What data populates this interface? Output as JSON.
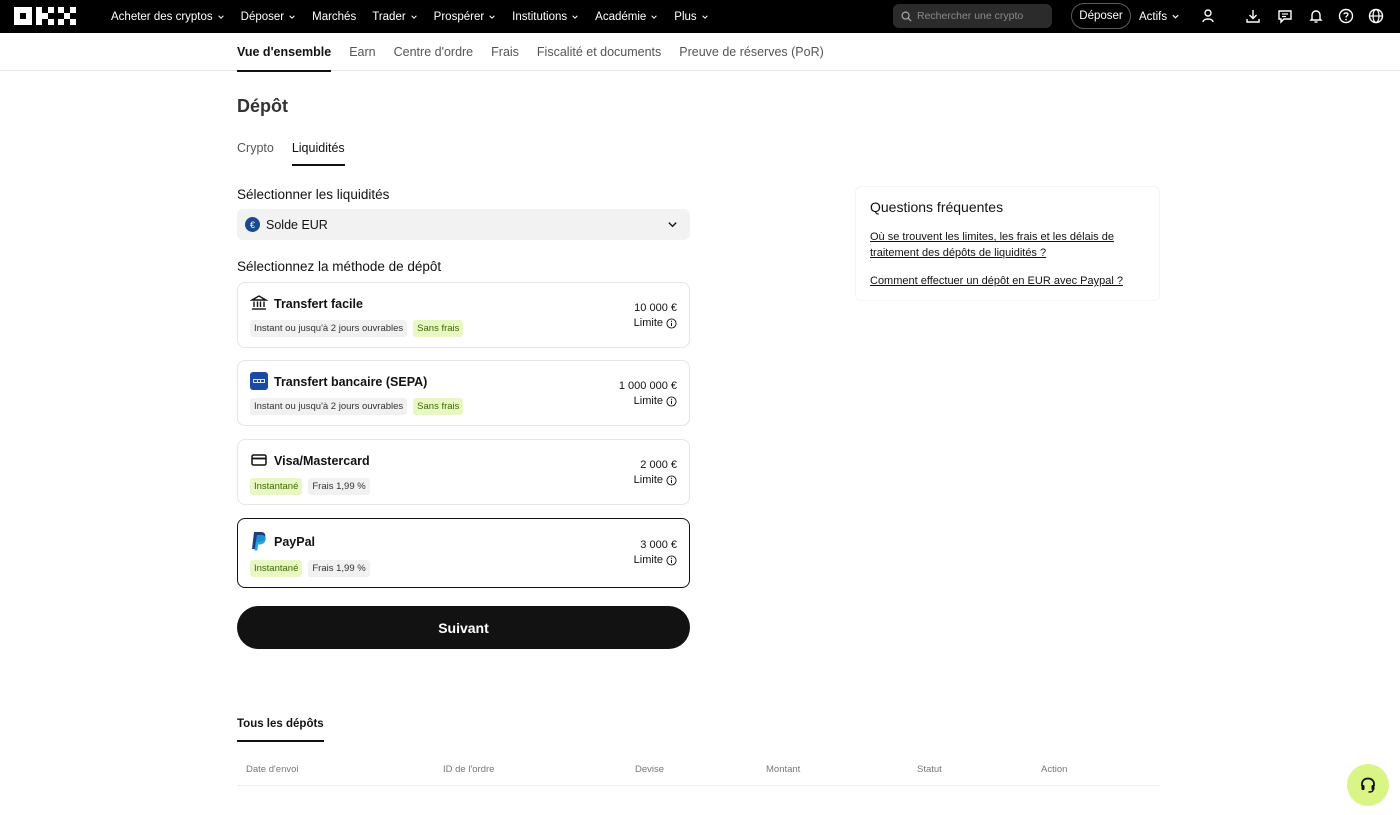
{
  "topnav": {
    "items": [
      {
        "label": "Acheter des cryptos",
        "dropdown": true
      },
      {
        "label": "Déposer",
        "dropdown": true
      },
      {
        "label": "Marchés",
        "dropdown": false
      },
      {
        "label": "Trader",
        "dropdown": true
      },
      {
        "label": "Prospérer",
        "dropdown": true
      },
      {
        "label": "Institutions",
        "dropdown": true
      },
      {
        "label": "Académie",
        "dropdown": true
      },
      {
        "label": "Plus",
        "dropdown": true
      }
    ],
    "search_placeholder": "Rechercher une crypto",
    "deposit_button": "Déposer",
    "assets_label": "Actifs",
    "icons": [
      "user-icon",
      "download-icon",
      "chat-icon",
      "bell-icon",
      "help-icon",
      "globe-icon"
    ]
  },
  "subnav": {
    "tabs": [
      "Vue d'ensemble",
      "Earn",
      "Centre d'ordre",
      "Frais",
      "Fiscalité et documents",
      "Preuve de réserves (PoR)"
    ],
    "active": 0
  },
  "page": {
    "title": "Dépôt",
    "tabs": [
      "Crypto",
      "Liquidités"
    ],
    "active_tab": 1,
    "select_currency_label": "Sélectionner les liquidités",
    "currency_value": "Solde EUR",
    "currency_icon_text": "€",
    "method_label": "Sélectionnez la méthode de dépôt",
    "next_button": "Suivant"
  },
  "methods": [
    {
      "name": "Transfert facile",
      "icon": "bank-icon",
      "badges": [
        {
          "text": "Instant ou jusqu'à 2 jours ouvrables",
          "style": "grey"
        },
        {
          "text": "Sans frais",
          "style": "green"
        }
      ],
      "amount": "10 000 €",
      "limit_label": "Limite",
      "selected": false
    },
    {
      "name": "Transfert bancaire (SEPA)",
      "icon": "sepa-icon",
      "badges": [
        {
          "text": "Instant ou jusqu'à 2 jours ouvrables",
          "style": "grey"
        },
        {
          "text": "Sans frais",
          "style": "green"
        }
      ],
      "amount": "1 000 000 €",
      "limit_label": "Limite",
      "selected": false
    },
    {
      "name": "Visa/Mastercard",
      "icon": "card-icon",
      "badges": [
        {
          "text": "Instantané",
          "style": "green"
        },
        {
          "text": "Frais 1,99 %",
          "style": "grey"
        }
      ],
      "amount": "2 000 €",
      "limit_label": "Limite",
      "selected": false
    },
    {
      "name": "PayPal",
      "icon": "paypal-icon",
      "badges": [
        {
          "text": "Instantané",
          "style": "green"
        },
        {
          "text": "Frais 1,99 %",
          "style": "grey"
        }
      ],
      "amount": "3 000 €",
      "limit_label": "Limite",
      "selected": true
    }
  ],
  "faq": {
    "title": "Questions fréquentes",
    "links": [
      "Où se trouvent les limites, les frais et les délais de traitement des dépôts de liquidités ?",
      "Comment effectuer un dépôt en EUR avec Paypal ?"
    ]
  },
  "history": {
    "tab": "Tous les dépôts",
    "columns": [
      "Date d'envoi",
      "ID de l'ordre",
      "Devise",
      "Montant",
      "Statut",
      "Action"
    ]
  },
  "colors": {
    "topbar": "#000000",
    "primary_button": "#121212",
    "green_badge_bg": "#e9f7c5",
    "support_button": "#d8f585"
  }
}
